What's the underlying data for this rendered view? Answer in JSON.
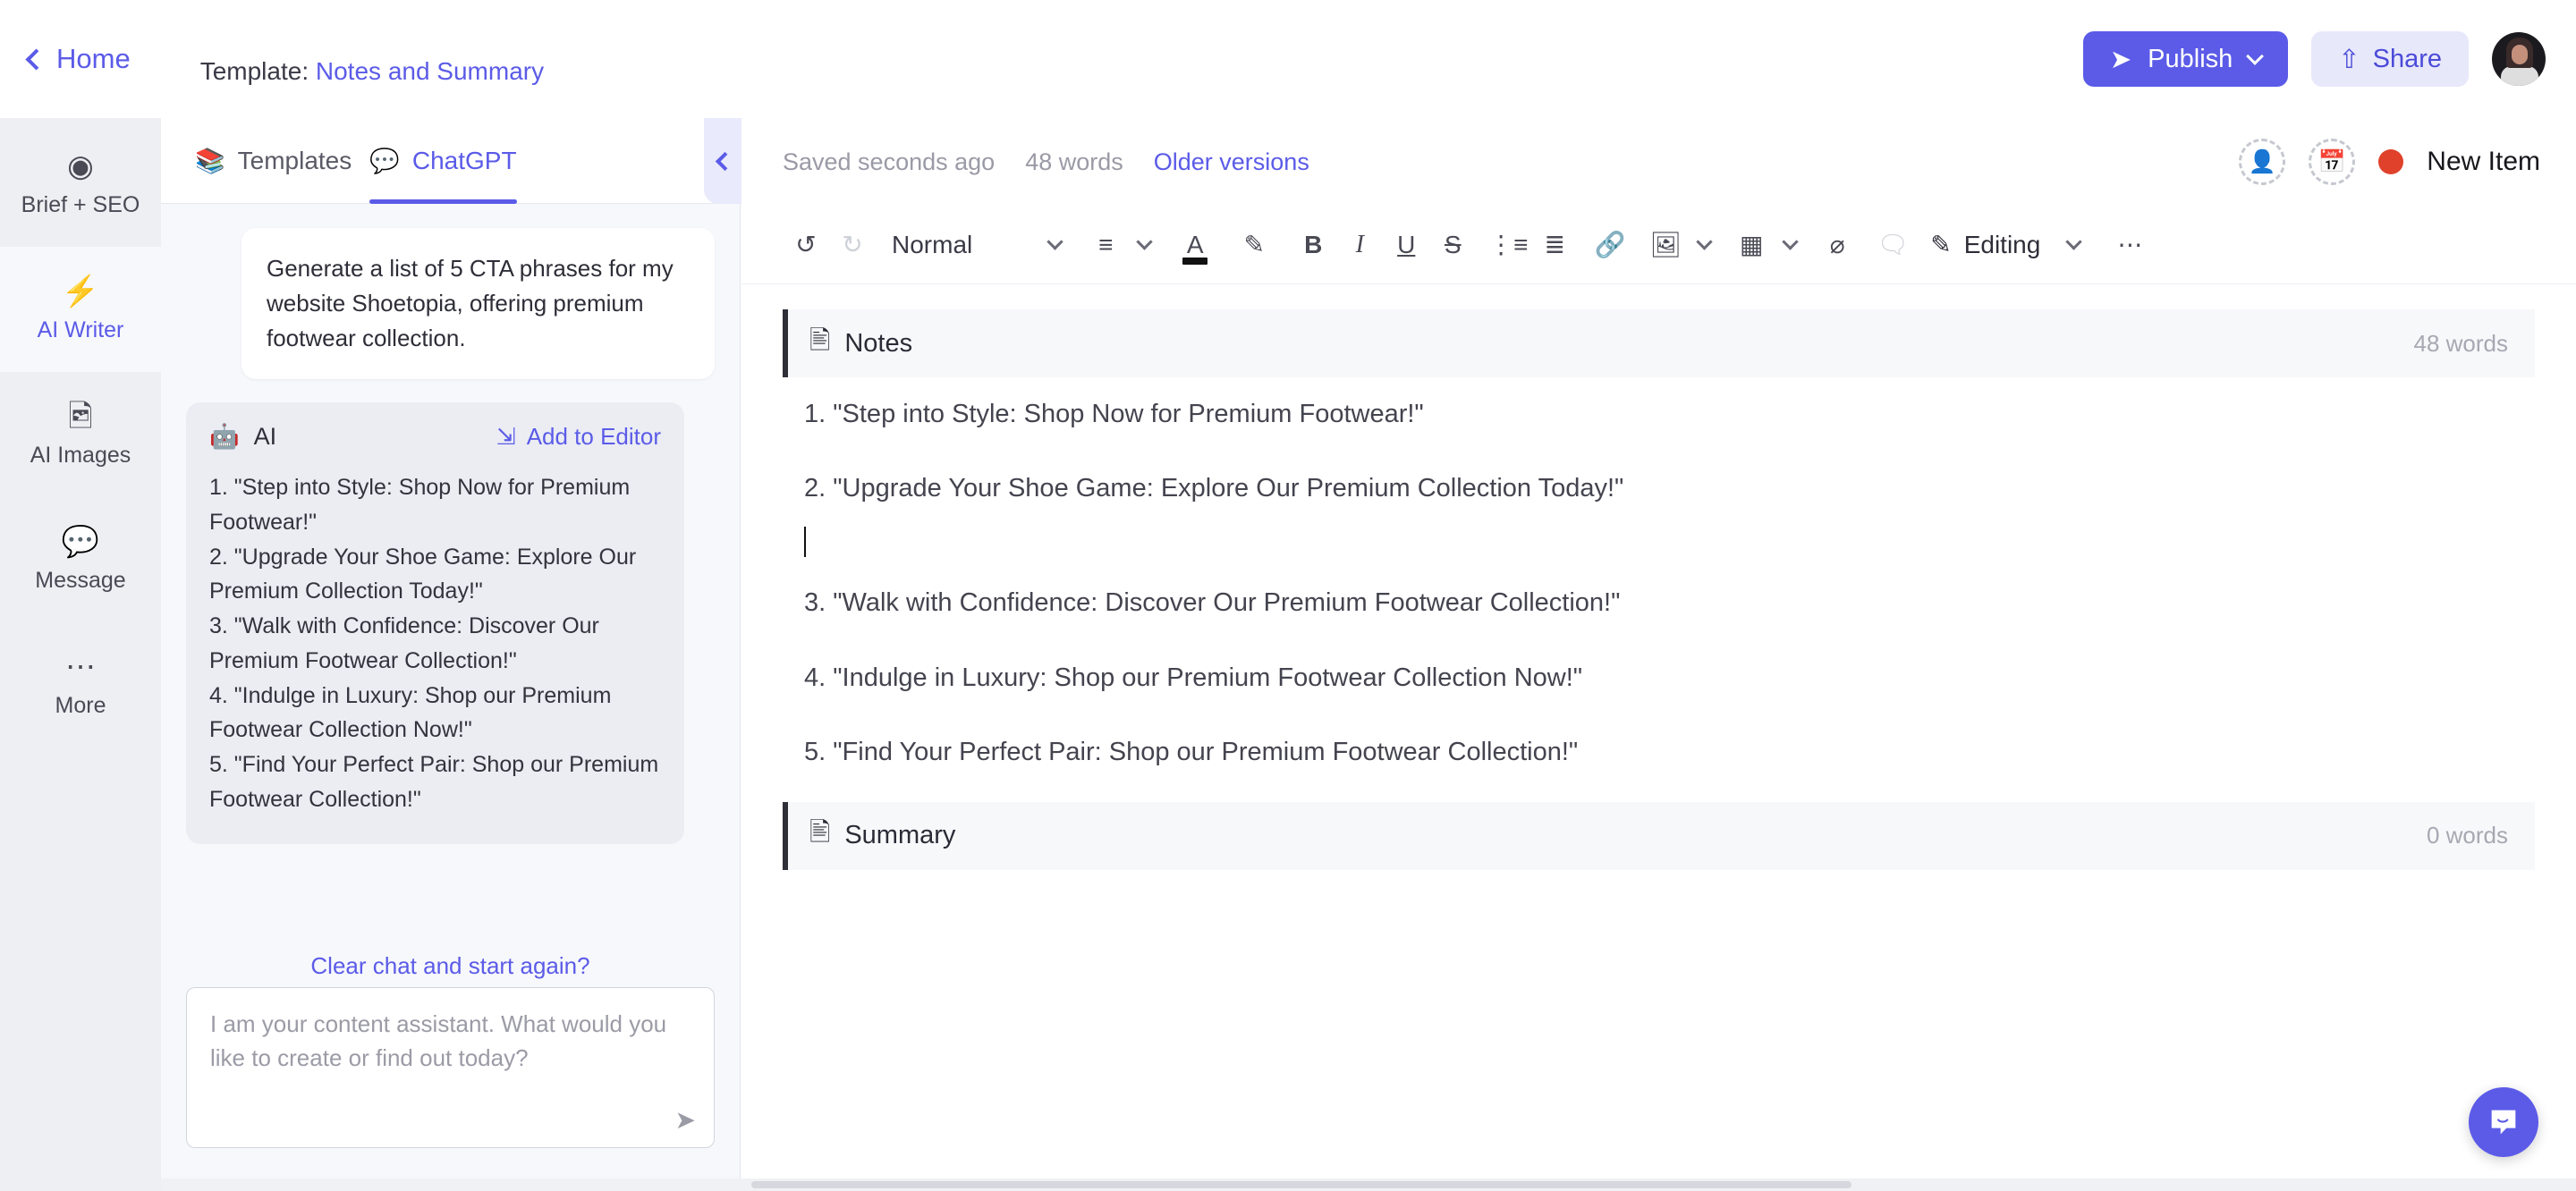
{
  "topbar": {
    "home_label": "Home",
    "template_prefix": "Template:",
    "template_name": "Notes and Summary",
    "publish_label": "Publish",
    "share_label": "Share",
    "publish_icon": "send-icon",
    "share_icon": "upload-icon",
    "avatar_icon": "user-avatar"
  },
  "rail": {
    "items": [
      {
        "label": "Brief + SEO",
        "icon": "target-icon",
        "active": false
      },
      {
        "label": "AI Writer",
        "icon": "lightning-icon",
        "active": true
      },
      {
        "label": "AI Images",
        "icon": "image-icon",
        "active": false
      },
      {
        "label": "Message",
        "icon": "message-icon",
        "active": false
      },
      {
        "label": "More",
        "icon": "ellipsis-icon",
        "active": false
      }
    ]
  },
  "chat": {
    "tabs": [
      {
        "label": "Templates",
        "icon": "books-icon",
        "active": false
      },
      {
        "label": "ChatGPT",
        "icon": "chat-bubbles-icon",
        "active": true
      }
    ],
    "collapse_icon": "chevron-left-icon",
    "user_message": "Generate a list of 5 CTA phrases for my website Shoetopia, offering premium footwear collection.",
    "ai_label": "AI",
    "ai_icon": "robot-icon",
    "add_to_editor_label": "Add to Editor",
    "add_to_editor_icon": "add-to-document-icon",
    "ai_response": "1. \"Step into Style: Shop Now for Premium Footwear!\"\n2. \"Upgrade Your Shoe Game: Explore Our Premium Collection Today!\"\n3. \"Walk with Confidence: Discover Our Premium Footwear Collection!\"\n4. \"Indulge in Luxury: Shop our Premium Footwear Collection Now!\"\n5. \"Find Your Perfect Pair: Shop our Premium Footwear Collection!\"",
    "clear_chat_label": "Clear chat and start again?",
    "composer_placeholder": "I am your content assistant. What would you like to create or find out today?",
    "composer_value": "",
    "send_icon": "send-icon"
  },
  "editor": {
    "saved_status": "Saved seconds ago",
    "word_count": "48 words",
    "older_versions_label": "Older versions",
    "add_person_icon": "add-person-icon",
    "add_date_icon": "add-date-icon",
    "status_badge": "New Item",
    "status_color": "#E0412A",
    "toolbar": {
      "undo_icon": "undo-icon",
      "redo_icon": "redo-icon",
      "style_label": "Normal",
      "align_icon": "align-icon",
      "text_color_icon": "text-color-icon",
      "text_color": "#111111",
      "highlight_icon": "highlighter-icon",
      "bold_icon": "bold-icon",
      "italic_icon": "italic-icon",
      "underline_icon": "underline-icon",
      "strikethrough_icon": "strikethrough-icon",
      "bullet_list_icon": "bullet-list-icon",
      "numbered_list_icon": "numbered-list-icon",
      "link_icon": "link-icon",
      "image_icon": "image-icon",
      "table_icon": "table-icon",
      "clear_format_icon": "clear-formatting-icon",
      "comment_icon": "add-comment-icon",
      "mode_label": "Editing",
      "mode_icon": "pencil-icon",
      "more_icon": "ellipsis-icon"
    },
    "sections": [
      {
        "title": "Notes",
        "icon": "document-icon",
        "words": "48 words"
      },
      {
        "title": "Summary",
        "icon": "document-icon",
        "words": "0 words"
      }
    ],
    "notes_lines": [
      "1. \"Step into Style: Shop Now for Premium Footwear!\"",
      "2. \"Upgrade Your Shoe Game: Explore Our Premium Collection Today!\"",
      "3. \"Walk with Confidence: Discover Our Premium Footwear Collection!\"",
      "4. \"Indulge in Luxury: Shop our Premium Footwear Collection Now!\"",
      "5. \"Find Your Perfect Pair: Shop our Premium Footwear Collection!\""
    ]
  },
  "fab": {
    "icon": "chat-smile-icon"
  }
}
